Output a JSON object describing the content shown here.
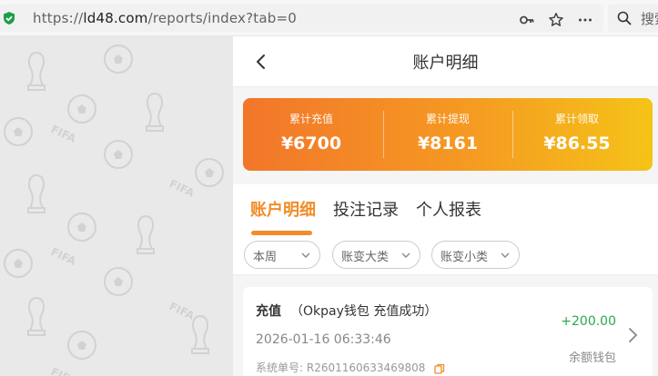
{
  "browser": {
    "url_prefix": "https://",
    "url_host": "ld48.com",
    "url_path": "/reports/index?tab=0",
    "search_placeholder": "搜索"
  },
  "watermark_text": "FIFA",
  "header": {
    "title": "账户明细"
  },
  "summary": {
    "items": [
      {
        "label": "累计充值",
        "value": "¥6700"
      },
      {
        "label": "累计提现",
        "value": "¥8161"
      },
      {
        "label": "累计领取",
        "value": "¥86.55"
      }
    ]
  },
  "tabs": [
    {
      "label": "账户明细",
      "active": true
    },
    {
      "label": "投注记录",
      "active": false
    },
    {
      "label": "个人报表",
      "active": false
    }
  ],
  "filters": [
    {
      "label": "本周"
    },
    {
      "label": "账变大类"
    },
    {
      "label": "账变小类"
    }
  ],
  "record": {
    "type": "充值",
    "desc": "（Okpay钱包 充值成功）",
    "time": "2026-01-16 06:33:46",
    "serial_label": "系统单号:",
    "serial_value": "R2601160633469808",
    "amount": "+200.00",
    "wallet": "余额钱包"
  },
  "colors": {
    "accent": "#f28c28",
    "positive": "#2aa84a",
    "gradient_start": "#f2762a",
    "gradient_end": "#f5c318"
  }
}
